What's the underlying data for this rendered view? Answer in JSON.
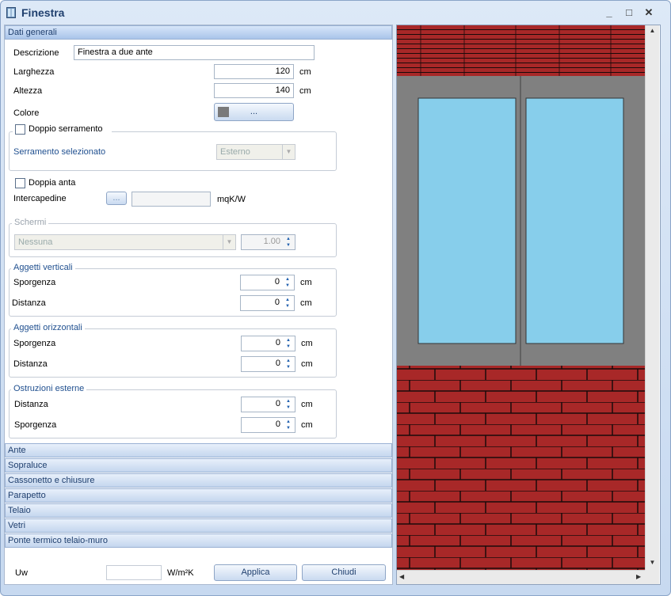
{
  "window": {
    "title": "Finestra",
    "minimize": "_",
    "maximize": "□",
    "close": "✕"
  },
  "sections": {
    "dati_generali": "Dati generali",
    "ante": "Ante",
    "sopraluce": "Sopraluce",
    "cassonetto": "Cassonetto e chiusure",
    "parapetto": "Parapetto",
    "telaio": "Telaio",
    "vetri": "Vetri",
    "ponte_termico": "Ponte termico telaio-muro"
  },
  "dati": {
    "descrizione_label": "Descrizione",
    "descrizione_value": "Finestra a due ante",
    "larghezza_label": "Larghezza",
    "larghezza_value": "120",
    "larghezza_unit": "cm",
    "altezza_label": "Altezza",
    "altezza_value": "140",
    "altezza_unit": "cm",
    "colore_label": "Colore",
    "colore_button": "...",
    "colore_swatch": "#7a7a7a",
    "doppio_serramento_label": "Doppio serramento",
    "serramento_selezionato_label": "Serramento selezionato",
    "serramento_selezionato_value": "Esterno",
    "doppia_anta_label": "Doppia anta",
    "intercapedine_label": "Intercapedine",
    "intercapedine_button": "...",
    "intercapedine_value": "",
    "intercapedine_unit": "mqK/W",
    "schermi_title": "Schermi",
    "schermi_value": "Nessuna",
    "schermi_factor": "1.00",
    "aggetti_verticali_title": "Aggetti verticali",
    "av_sporgenza_label": "Sporgenza",
    "av_sporgenza_value": "0",
    "av_sporgenza_unit": "cm",
    "av_distanza_label": "Distanza",
    "av_distanza_value": "0",
    "av_distanza_unit": "cm",
    "aggetti_orizzontali_title": "Aggetti orizzontali",
    "ao_sporgenza_label": "Sporgenza",
    "ao_sporgenza_value": "0",
    "ao_sporgenza_unit": "cm",
    "ao_distanza_label": "Distanza",
    "ao_distanza_value": "0",
    "ao_distanza_unit": "cm",
    "ostruzioni_title": "Ostruzioni esterne",
    "oe_distanza_label": "Distanza",
    "oe_distanza_value": "0",
    "oe_distanza_unit": "cm",
    "oe_sporgenza_label": "Sporgenza",
    "oe_sporgenza_value": "0",
    "oe_sporgenza_unit": "cm"
  },
  "footer": {
    "uw_label": "Uw",
    "uw_value": "",
    "uw_unit": "W/m²K",
    "applica": "Applica",
    "chiudi": "Chiudi"
  },
  "preview": {
    "colors": {
      "brick": "#a82828",
      "mortar": "#1a0a0a",
      "frame": "#808080",
      "glass": "#87ceeb"
    }
  }
}
